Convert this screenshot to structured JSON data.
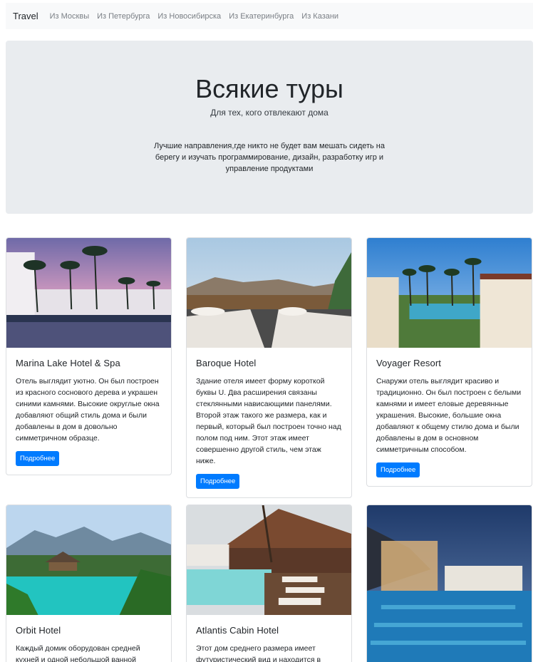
{
  "navbar": {
    "brand": "Travel",
    "links": [
      "Из Москвы",
      "Из Петербурга",
      "Из Новосибирска",
      "Из Екатеринбурга",
      "Из Казани"
    ]
  },
  "hero": {
    "title": "Всякие туры",
    "subtitle": "Для тех, кого отвлекают дома",
    "description": "Лучшие направления,где никто не будет вам мешать сидеть на берегу и изучать программирование, дизайн, разработку игр и управление продуктами"
  },
  "cards": [
    {
      "title": "Marina Lake Hotel & Spa",
      "text": "Отель выглядит уютно. Он был построен из красного соснового дерева и украшен синими камнями. Высокие округлые окна добавляют общий стиль дома и были добавлены в дом в довольно симметричном образце.",
      "button": "Подробнее"
    },
    {
      "title": "Baroque Hotel",
      "text": "Здание отеля имеет форму короткой буквы U. Два расширения связаны стеклянными нависающими панелями. Второй этаж такого же размера, как и первый, который был построен точно над полом под ним. Этот этаж имеет совершенно другой стиль, чем этаж ниже.",
      "button": "Подробнее"
    },
    {
      "title": "Voyager Resort",
      "text": "Снаружи отель выглядит красиво и традиционно. Он был построен с белыми камнями и имеет еловые деревянные украшения. Высокие, большие окна добавляют к общему стилю дома и были добавлены в дом в основном симметричным способом.",
      "button": "Подробнее"
    },
    {
      "title": "Orbit Hotel",
      "text": "Каждый домик оборудован средней кухней и одной небольшой ванной"
    },
    {
      "title": "Atlantis Cabin Hotel",
      "text": "Этот дом среднего размера имеет футуристический вид и находится в"
    },
    {
      "title": "",
      "text": ""
    }
  ]
}
